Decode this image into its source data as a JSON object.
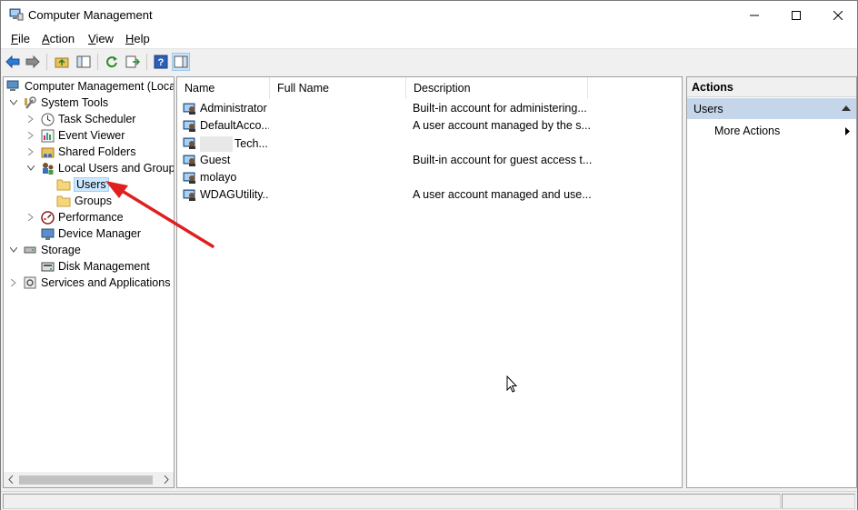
{
  "window": {
    "title": "Computer Management"
  },
  "menu": {
    "items": [
      {
        "accel": "F",
        "rest": "ile"
      },
      {
        "accel": "A",
        "rest": "ction"
      },
      {
        "accel": "V",
        "rest": "iew"
      },
      {
        "accel": "H",
        "rest": "elp"
      }
    ]
  },
  "tree": {
    "root": "Computer Management (Local",
    "system_tools": "System Tools",
    "task_scheduler": "Task Scheduler",
    "event_viewer": "Event Viewer",
    "shared_folders": "Shared Folders",
    "local_users_groups": "Local Users and Groups",
    "users": "Users",
    "groups": "Groups",
    "performance": "Performance",
    "device_manager": "Device Manager",
    "storage": "Storage",
    "disk_management": "Disk Management",
    "services_apps": "Services and Applications"
  },
  "list": {
    "columns": [
      "Name",
      "Full Name",
      "Description"
    ],
    "rows": [
      {
        "name": "Administrator",
        "full_name": "",
        "description": "Built-in account for administering..."
      },
      {
        "name": "DefaultAcco...",
        "full_name": "",
        "description": "A user account managed by the s..."
      },
      {
        "name": "Tech...",
        "full_name": "",
        "description": ""
      },
      {
        "name": "Guest",
        "full_name": "",
        "description": "Built-in account for guest access t..."
      },
      {
        "name": "molayo",
        "full_name": "",
        "description": ""
      },
      {
        "name": "WDAGUtility...",
        "full_name": "",
        "description": "A user account managed and use..."
      }
    ]
  },
  "actions": {
    "title": "Actions",
    "section": "Users",
    "more": "More Actions"
  },
  "colors": {
    "annotation_arrow": "#e02020",
    "selection": "#cce8ff",
    "actions_section": "#c6d6ea"
  }
}
